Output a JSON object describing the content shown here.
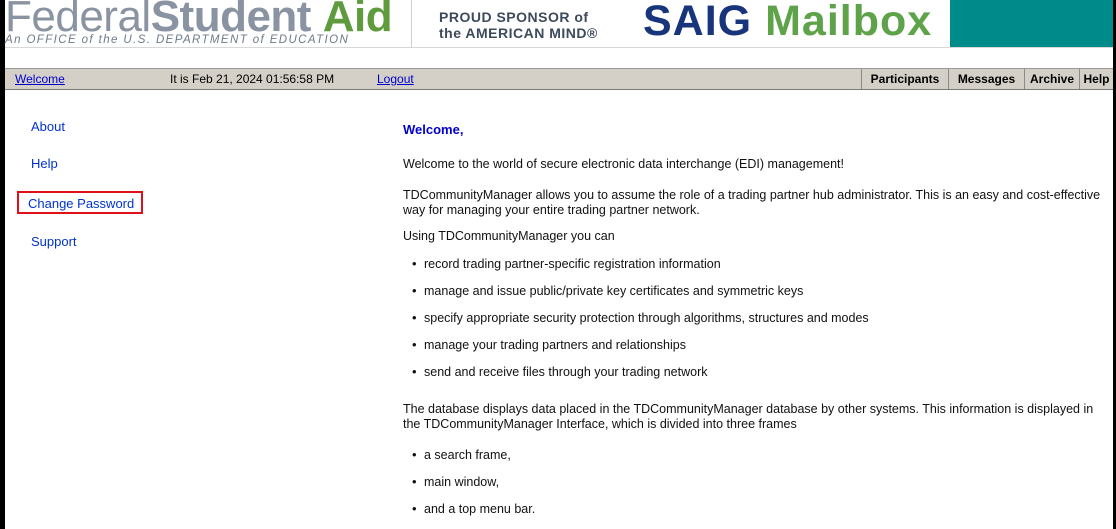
{
  "header": {
    "logo_thin": "Federal",
    "logo_bold": "Student",
    "logo_aid": "Aid",
    "logo_sub": "An OFFICE of the U.S. DEPARTMENT of EDUCATION",
    "sponsor_line1": "PROUD SPONSOR of",
    "sponsor_line2": "the AMERICAN MIND®",
    "app_title_1": "SAIG",
    "app_title_2": "Mailbox",
    "teal_color": "#008b8b"
  },
  "navbar": {
    "welcome_link": "Welcome",
    "date_text": "It is Feb 21, 2024 01:56:58 PM",
    "logout_link": "Logout",
    "tabs": [
      "Participants",
      "Messages",
      "Archive",
      "Help"
    ]
  },
  "sidebar": {
    "items": [
      "About",
      "Help",
      "Change Password",
      "Support"
    ],
    "highlighted": "Change Password",
    "highlight_color": "#e0101a"
  },
  "main": {
    "heading": "Welcome,",
    "intro": "Welcome to the world of secure electronic data interchange (EDI) management!",
    "p1": "TDCommunityManager allows you to assume the role of a trading partner hub administrator. This is an easy and cost-effective way for managing your entire trading partner network.",
    "p2": "Using TDCommunityManager you can",
    "bullets1": [
      "record trading partner-specific registration information",
      "manage and issue public/private key certificates and symmetric keys",
      "specify appropriate security protection through algorithms, structures and modes",
      "manage your trading partners and relationships",
      "send and receive files through your trading network"
    ],
    "p3": "The database displays data placed in the TDCommunityManager database by other systems. This information is displayed in the TDCommunityManager Interface, which is divided into three frames",
    "bullets2": [
      "a search frame,",
      "main window,",
      "and a top menu bar."
    ]
  }
}
